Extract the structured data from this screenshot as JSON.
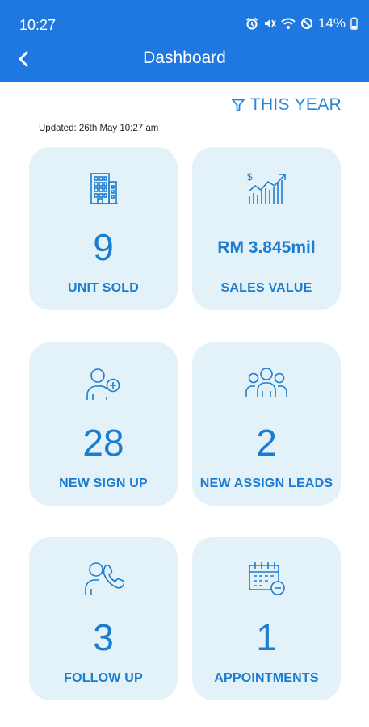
{
  "status_bar": {
    "time": "10:27",
    "battery": "14%"
  },
  "header": {
    "title": "Dashboard"
  },
  "filter": {
    "label": "THIS YEAR",
    "icon": "filter-icon"
  },
  "updated": "Updated: 26th May 10:27 am",
  "colors": {
    "appbar": "#1f78e0",
    "accent": "#1c7cd0",
    "card_bg": "#e3f2f8"
  },
  "cards": [
    {
      "icon": "building-icon",
      "value": "9",
      "label": "UNIT SOLD"
    },
    {
      "icon": "sales-chart-icon",
      "value": "RM 3.845mil",
      "label": "SALES VALUE"
    },
    {
      "icon": "user-add-icon",
      "value": "28",
      "label": "NEW SIGN UP"
    },
    {
      "icon": "group-icon",
      "value": "2",
      "label": "NEW ASSIGN LEADS"
    },
    {
      "icon": "user-phone-icon",
      "value": "3",
      "label": "FOLLOW UP"
    },
    {
      "icon": "calendar-icon",
      "value": "1",
      "label": "APPOINTMENTS"
    }
  ]
}
